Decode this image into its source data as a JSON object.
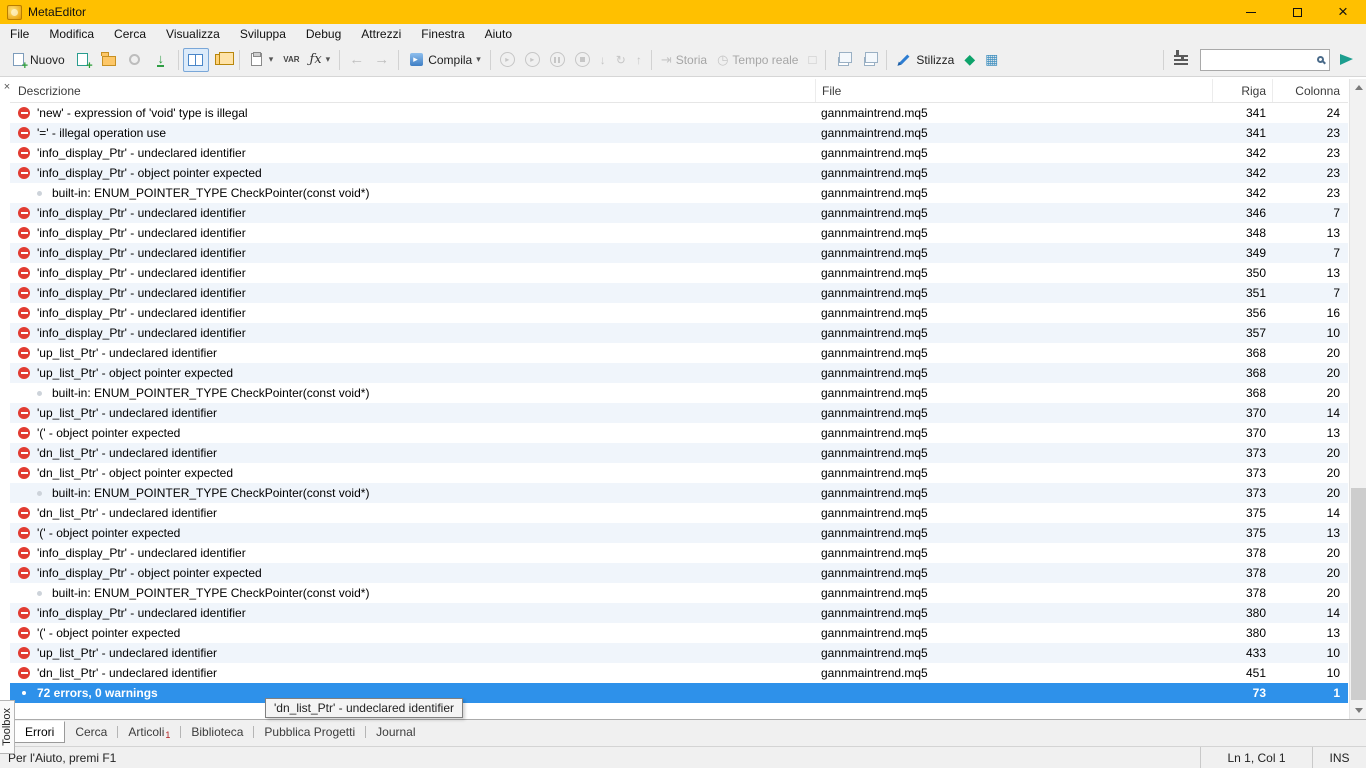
{
  "window": {
    "title": "MetaEditor"
  },
  "menu": {
    "items": [
      "File",
      "Modifica",
      "Cerca",
      "Visualizza",
      "Sviluppa",
      "Debug",
      "Attrezzi",
      "Finestra",
      "Aiuto"
    ]
  },
  "toolbar": {
    "new_label": "Nuovo",
    "compile_label": "Compila",
    "history_label": "Storia",
    "realtime_label": "Tempo reale",
    "stylize_label": "Stilizza",
    "var_label": "VAR",
    "fx_label": "ƒx",
    "search_value": ""
  },
  "errors_panel": {
    "columns": [
      "Descrizione",
      "File",
      "Riga",
      "Colonna"
    ],
    "tooltip": "'dn_list_Ptr' - undeclared identifier",
    "rows": [
      {
        "icon": "error",
        "description": "'new' - expression of 'void' type is illegal",
        "file": "gannmaintrend.mq5",
        "line": 341,
        "column": 24
      },
      {
        "icon": "error",
        "description": "'=' - illegal operation use",
        "file": "gannmaintrend.mq5",
        "line": 341,
        "column": 23
      },
      {
        "icon": "error",
        "description": "'info_display_Ptr' - undeclared identifier",
        "file": "gannmaintrend.mq5",
        "line": 342,
        "column": 23
      },
      {
        "icon": "error",
        "description": "'info_display_Ptr' - object pointer expected",
        "file": "gannmaintrend.mq5",
        "line": 342,
        "column": 23
      },
      {
        "icon": "info",
        "description": "built-in: ENUM_POINTER_TYPE CheckPointer(const void*)",
        "file": "gannmaintrend.mq5",
        "line": 342,
        "column": 23
      },
      {
        "icon": "error",
        "description": "'info_display_Ptr' - undeclared identifier",
        "file": "gannmaintrend.mq5",
        "line": 346,
        "column": 7
      },
      {
        "icon": "error",
        "description": "'info_display_Ptr' - undeclared identifier",
        "file": "gannmaintrend.mq5",
        "line": 348,
        "column": 13
      },
      {
        "icon": "error",
        "description": "'info_display_Ptr' - undeclared identifier",
        "file": "gannmaintrend.mq5",
        "line": 349,
        "column": 7
      },
      {
        "icon": "error",
        "description": "'info_display_Ptr' - undeclared identifier",
        "file": "gannmaintrend.mq5",
        "line": 350,
        "column": 13
      },
      {
        "icon": "error",
        "description": "'info_display_Ptr' - undeclared identifier",
        "file": "gannmaintrend.mq5",
        "line": 351,
        "column": 7
      },
      {
        "icon": "error",
        "description": "'info_display_Ptr' - undeclared identifier",
        "file": "gannmaintrend.mq5",
        "line": 356,
        "column": 16
      },
      {
        "icon": "error",
        "description": "'info_display_Ptr' - undeclared identifier",
        "file": "gannmaintrend.mq5",
        "line": 357,
        "column": 10
      },
      {
        "icon": "error",
        "description": "'up_list_Ptr' - undeclared identifier",
        "file": "gannmaintrend.mq5",
        "line": 368,
        "column": 20
      },
      {
        "icon": "error",
        "description": "'up_list_Ptr' - object pointer expected",
        "file": "gannmaintrend.mq5",
        "line": 368,
        "column": 20
      },
      {
        "icon": "info",
        "description": "built-in: ENUM_POINTER_TYPE CheckPointer(const void*)",
        "file": "gannmaintrend.mq5",
        "line": 368,
        "column": 20
      },
      {
        "icon": "error",
        "description": "'up_list_Ptr' - undeclared identifier",
        "file": "gannmaintrend.mq5",
        "line": 370,
        "column": 14
      },
      {
        "icon": "error",
        "description": "'(' - object pointer expected",
        "file": "gannmaintrend.mq5",
        "line": 370,
        "column": 13
      },
      {
        "icon": "error",
        "description": "'dn_list_Ptr' - undeclared identifier",
        "file": "gannmaintrend.mq5",
        "line": 373,
        "column": 20
      },
      {
        "icon": "error",
        "description": "'dn_list_Ptr' - object pointer expected",
        "file": "gannmaintrend.mq5",
        "line": 373,
        "column": 20
      },
      {
        "icon": "info",
        "description": "built-in: ENUM_POINTER_TYPE CheckPointer(const void*)",
        "file": "gannmaintrend.mq5",
        "line": 373,
        "column": 20
      },
      {
        "icon": "error",
        "description": "'dn_list_Ptr' - undeclared identifier",
        "file": "gannmaintrend.mq5",
        "line": 375,
        "column": 14
      },
      {
        "icon": "error",
        "description": "'(' - object pointer expected",
        "file": "gannmaintrend.mq5",
        "line": 375,
        "column": 13
      },
      {
        "icon": "error",
        "description": "'info_display_Ptr' - undeclared identifier",
        "file": "gannmaintrend.mq5",
        "line": 378,
        "column": 20
      },
      {
        "icon": "error",
        "description": "'info_display_Ptr' - object pointer expected",
        "file": "gannmaintrend.mq5",
        "line": 378,
        "column": 20
      },
      {
        "icon": "info",
        "description": "built-in: ENUM_POINTER_TYPE CheckPointer(const void*)",
        "file": "gannmaintrend.mq5",
        "line": 378,
        "column": 20
      },
      {
        "icon": "error",
        "description": "'info_display_Ptr' - undeclared identifier",
        "file": "gannmaintrend.mq5",
        "line": 380,
        "column": 14
      },
      {
        "icon": "error",
        "description": "'(' - object pointer expected",
        "file": "gannmaintrend.mq5",
        "line": 380,
        "column": 13
      },
      {
        "icon": "error",
        "description": "'up_list_Ptr' - undeclared identifier",
        "file": "gannmaintrend.mq5",
        "line": 433,
        "column": 10
      },
      {
        "icon": "error",
        "description": "'dn_list_Ptr' - undeclared identifier",
        "file": "gannmaintrend.mq5",
        "line": 451,
        "column": 10
      },
      {
        "icon": "dot",
        "description": "72 errors, 0 warnings",
        "file": "",
        "line": 73,
        "column": 1,
        "selected": true
      }
    ]
  },
  "tabs": {
    "items": [
      {
        "label": "Errori",
        "active": true
      },
      {
        "label": "Cerca"
      },
      {
        "label": "Articoli",
        "badge": "1"
      },
      {
        "label": "Biblioteca"
      },
      {
        "label": "Pubblica Progetti"
      },
      {
        "label": "Journal"
      }
    ]
  },
  "toolbox": {
    "label": "Toolbox"
  },
  "statusbar": {
    "help_text": "Per l'Aiuto, premi F1",
    "cursor_position": "Ln 1, Col 1",
    "insert_mode": "INS"
  }
}
